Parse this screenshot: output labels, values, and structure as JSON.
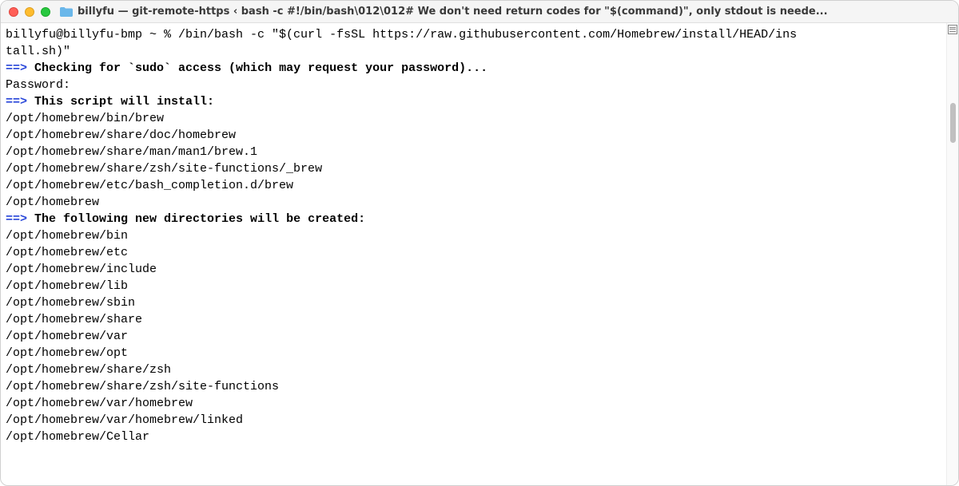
{
  "titlebar": {
    "title": "billyfu — git-remote-https ‹ bash -c #!/bin/bash\\012\\012# We don't need return codes for \"$(command)\", only stdout is neede..."
  },
  "terminal": {
    "prompt_line1": "billyfu@billyfu-bmp ~ % /bin/bash -c \"$(curl -fsSL https://raw.githubusercontent.com/Homebrew/install/HEAD/ins",
    "prompt_line2": "tall.sh)\"",
    "arrow1": "==>",
    "check_sudo": " Checking for `sudo` access (which may request your password)...",
    "password_prompt": "Password:",
    "arrow2": "==>",
    "will_install": " This script will install:",
    "install_paths": [
      "/opt/homebrew/bin/brew",
      "/opt/homebrew/share/doc/homebrew",
      "/opt/homebrew/share/man/man1/brew.1",
      "/opt/homebrew/share/zsh/site-functions/_brew",
      "/opt/homebrew/etc/bash_completion.d/brew",
      "/opt/homebrew"
    ],
    "arrow3": "==>",
    "new_dirs": " The following new directories will be created:",
    "dir_paths": [
      "/opt/homebrew/bin",
      "/opt/homebrew/etc",
      "/opt/homebrew/include",
      "/opt/homebrew/lib",
      "/opt/homebrew/sbin",
      "/opt/homebrew/share",
      "/opt/homebrew/var",
      "/opt/homebrew/opt",
      "/opt/homebrew/share/zsh",
      "/opt/homebrew/share/zsh/site-functions",
      "/opt/homebrew/var/homebrew",
      "/opt/homebrew/var/homebrew/linked",
      "/opt/homebrew/Cellar"
    ]
  }
}
